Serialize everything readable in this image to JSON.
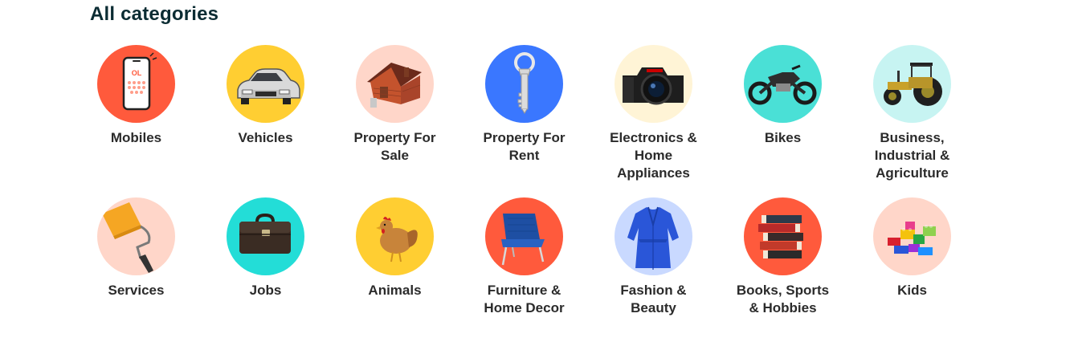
{
  "section": {
    "title": "All categories"
  },
  "categories": [
    {
      "label": "Mobiles",
      "icon": "mobile-phone-icon",
      "bg": "#ff5a3c"
    },
    {
      "label": "Vehicles",
      "icon": "car-icon",
      "bg": "#ffce32"
    },
    {
      "label": "Property For\nSale",
      "icon": "house-icon",
      "bg": "#ffd6c9"
    },
    {
      "label": "Property For\nRent",
      "icon": "key-icon",
      "bg": "#3a77ff"
    },
    {
      "label": "Electronics &\nHome\nAppliances",
      "icon": "camera-icon",
      "bg": "#fff4d6"
    },
    {
      "label": "Bikes",
      "icon": "motorbike-icon",
      "bg": "#4ae0d6"
    },
    {
      "label": "Business,\nIndustrial &\nAgriculture",
      "icon": "tractor-icon",
      "bg": "#c7f4f2"
    },
    {
      "label": "Services",
      "icon": "paint-roller-icon",
      "bg": "#ffd6c9"
    },
    {
      "label": "Jobs",
      "icon": "briefcase-icon",
      "bg": "#23ddd7"
    },
    {
      "label": "Animals",
      "icon": "chicken-icon",
      "bg": "#ffce32"
    },
    {
      "label": "Furniture &\nHome Decor",
      "icon": "chair-icon",
      "bg": "#ff5a3c"
    },
    {
      "label": "Fashion &\nBeauty",
      "icon": "dress-icon",
      "bg": "#c9d9ff"
    },
    {
      "label": "Books, Sports\n& Hobbies",
      "icon": "books-icon",
      "bg": "#ff5a3c"
    },
    {
      "label": "Kids",
      "icon": "toy-blocks-icon",
      "bg": "#ffd6c9"
    }
  ]
}
